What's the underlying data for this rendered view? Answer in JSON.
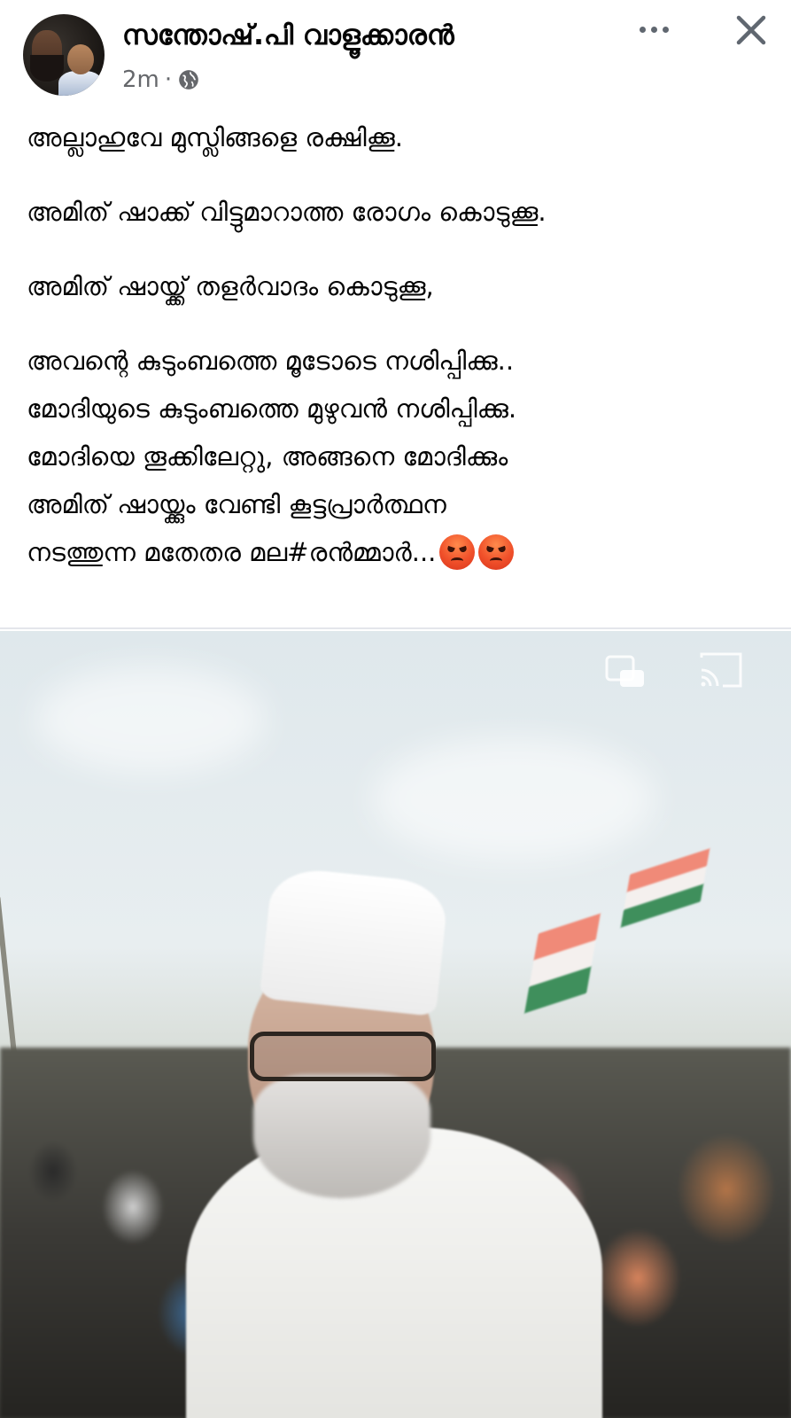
{
  "post": {
    "author": "സന്തോഷ്.പി വാളൂക്കാരൻ",
    "time": "2m",
    "separator": "·",
    "privacy_icon": "globe-icon",
    "more_icon": "more-icon",
    "close_icon": "close-icon",
    "lines": [
      "അല്ലാഹുവേ മുസ്ലിങ്ങളെ രക്ഷിക്കൂ.",
      "അമിത് ഷാക്ക് വിട്ടുമാറാത്ത രോഗം കൊടുക്കൂ.",
      "അമിത് ഷായ്ക്ക് തളർവാദം കൊടുക്കൂ,",
      "അവന്റെ കുടുംബത്തെ മൂടോടെ നശിപ്പിക്കു..",
      "മോദിയുടെ കുടുംബത്തെ മുഴുവൻ നശിപ്പിക്കു.",
      "മോദിയെ തൂക്കിലേറ്റു, അങ്ങനെ മോദിക്കും",
      "അമിത് ഷായ്ക്കും വേണ്ടി കൂട്ടപ്രാർത്ഥന",
      "നടത്തുന്ന മതേതര മല#രൻമ്മാർ..."
    ],
    "end_emojis": [
      "angry-face-emoji",
      "angry-face-emoji"
    ]
  },
  "video": {
    "pip_icon": "picture-in-picture-icon",
    "cast_icon": "cast-icon"
  },
  "colors": {
    "name": "#050505",
    "meta": "#65676b",
    "divider": "#e4e6eb"
  }
}
